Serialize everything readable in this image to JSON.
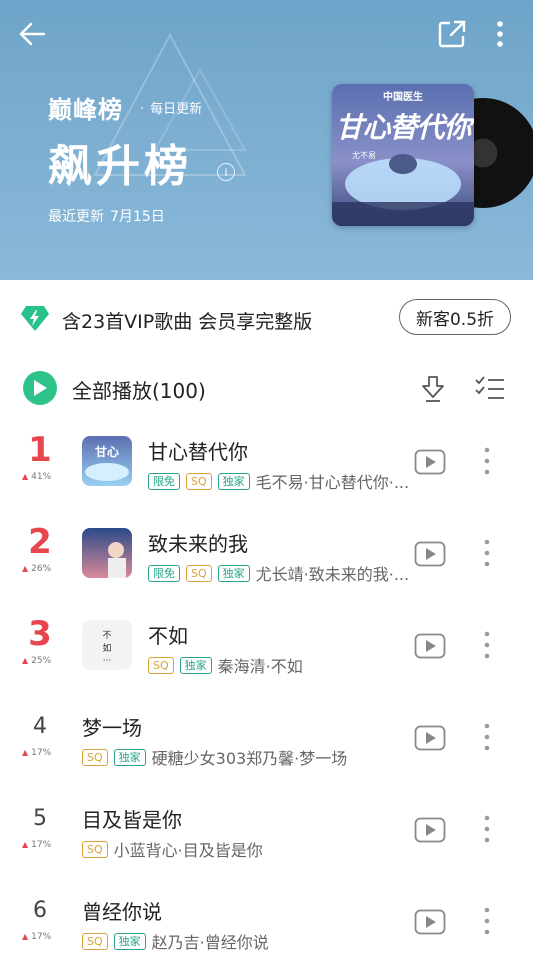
{
  "header": {
    "brand": "巅峰榜",
    "frequency": "每日更新",
    "title": "飙升榜",
    "updated_label": "最近更新",
    "updated_date": "7月15日",
    "cover": {
      "tag": "中国医生",
      "title": "甘心替代你",
      "artist": "尤不易"
    }
  },
  "vip": {
    "text": "含23首VIP歌曲 会员享完整版",
    "button": "新客0.5折"
  },
  "play_all": {
    "label": "全部播放(100)"
  },
  "tags": {
    "free": "限免",
    "sq": "SQ",
    "exclusive": "独家"
  },
  "songs": [
    {
      "rank": "1",
      "trend": "41%",
      "title": "甘心替代你",
      "artist": "毛不易·甘心替代你·...",
      "free": true,
      "sq": true,
      "exclusive": true,
      "thumb": "a"
    },
    {
      "rank": "2",
      "trend": "26%",
      "title": "致未来的我",
      "artist": "尤长靖·致未来的我·...",
      "free": true,
      "sq": true,
      "exclusive": true,
      "thumb": "b"
    },
    {
      "rank": "3",
      "trend": "25%",
      "title": "不如",
      "artist": "秦海清·不如",
      "free": false,
      "sq": true,
      "exclusive": true,
      "thumb": "c"
    },
    {
      "rank": "4",
      "trend": "17%",
      "title": "梦一场",
      "artist": "硬糖少女303郑乃馨·梦一场",
      "free": false,
      "sq": true,
      "exclusive": true,
      "thumb": ""
    },
    {
      "rank": "5",
      "trend": "17%",
      "title": "目及皆是你",
      "artist": "小蓝背心·目及皆是你",
      "free": false,
      "sq": true,
      "exclusive": false,
      "thumb": ""
    },
    {
      "rank": "6",
      "trend": "17%",
      "title": "曾经你说",
      "artist": "赵乃吉·曾经你说",
      "free": false,
      "sq": true,
      "exclusive": true,
      "thumb": ""
    }
  ],
  "colors": {
    "accent": "#2ec38b",
    "rank_top": "#e8464e",
    "header_bg": "#7aaed2"
  }
}
